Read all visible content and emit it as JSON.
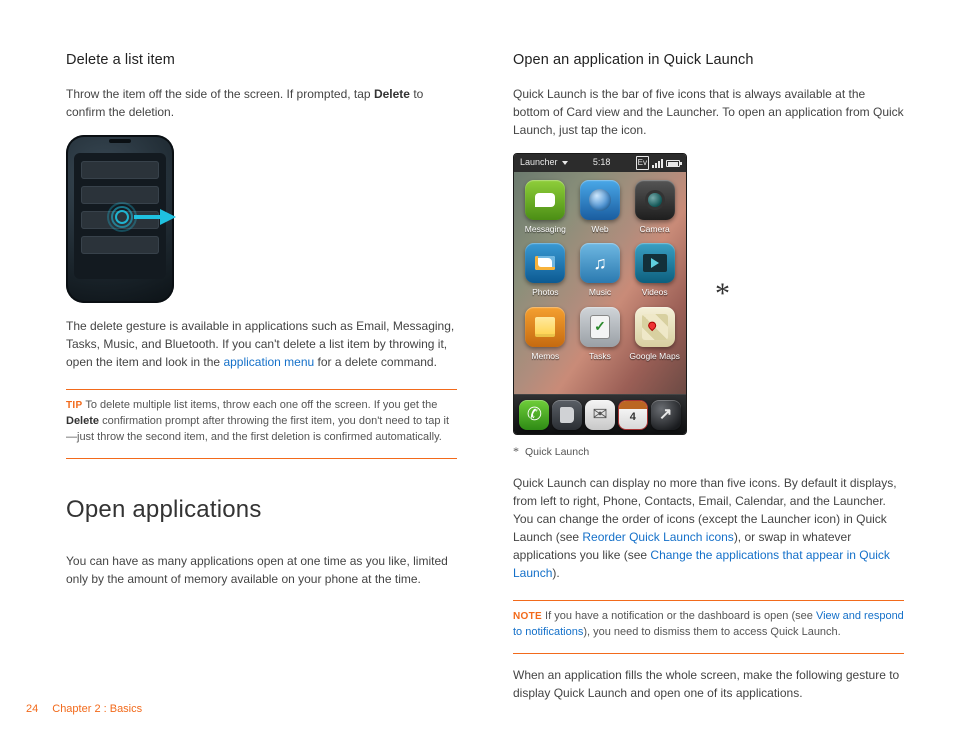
{
  "page_number": "24",
  "chapter_line": "Chapter 2 : Basics",
  "left": {
    "h_delete": "Delete a list item",
    "p_throw_1": "Throw the item off the side of the screen. If prompted, tap ",
    "p_throw_bold": "Delete",
    "p_throw_2": " to confirm the deletion.",
    "p_avail_1": "The delete gesture is available in applications such as Email, Messaging, Tasks, Music, and Bluetooth. If you can't delete a list item by throwing it, open the item and look in the ",
    "p_avail_link": "application menu",
    "p_avail_2": " for a delete command.",
    "tip_label": "TIP",
    "tip_1": "  To delete multiple list items, throw each one off the screen. If you get the ",
    "tip_bold": "Delete",
    "tip_2": " confirmation prompt after throwing the first item, you don't need to tap it—just throw the second item, and the first deletion is confirmed automatically.",
    "h_open_apps": "Open applications",
    "p_open_apps": "You can have as many applications open at one time as you like, limited only by the amount of memory available on your phone at the time."
  },
  "right": {
    "h_ql": "Open an application in Quick Launch",
    "p_ql_intro": "Quick Launch is the bar of five icons that is always available at the bottom of Card view and the Launcher. To open an application from Quick Launch, just tap the icon.",
    "statusbar": {
      "left_label": "Launcher",
      "time": "5:18",
      "ev_label": "Ev"
    },
    "apps": [
      {
        "name": "messaging",
        "label": "Messaging"
      },
      {
        "name": "web",
        "label": "Web"
      },
      {
        "name": "camera",
        "label": "Camera"
      },
      {
        "name": "photos",
        "label": "Photos"
      },
      {
        "name": "music",
        "label": "Music"
      },
      {
        "name": "videos",
        "label": "Videos"
      },
      {
        "name": "memos",
        "label": "Memos"
      },
      {
        "name": "tasks",
        "label": "Tasks"
      },
      {
        "name": "google-maps",
        "label": "Google Maps"
      }
    ],
    "ql_icons": [
      "phone",
      "contacts",
      "email",
      "calendar",
      "launcher"
    ],
    "calendar_day": "4",
    "asterisk": "*",
    "caption": "Quick Launch",
    "p_ql_body_1": "Quick Launch can display no more than five icons. By default it displays, from left to right, Phone, Contacts, Email, Calendar, and the Launcher. You can change the order of icons (except the Launcher icon) in Quick Launch (see ",
    "p_ql_link1": "Reorder Quick Launch icons",
    "p_ql_body_2": "), or swap in whatever applications you like (see ",
    "p_ql_link2": "Change the applications that appear in Quick Launch",
    "p_ql_body_3": ").",
    "note_label": "NOTE",
    "note_1": "  If you have a notification or the dashboard is open (see ",
    "note_link": "View and respond to notifications",
    "note_2": "), you need to dismiss them to access Quick Launch.",
    "p_final": "When an application fills the whole screen, make the following gesture to display Quick Launch and open one of its applications."
  }
}
